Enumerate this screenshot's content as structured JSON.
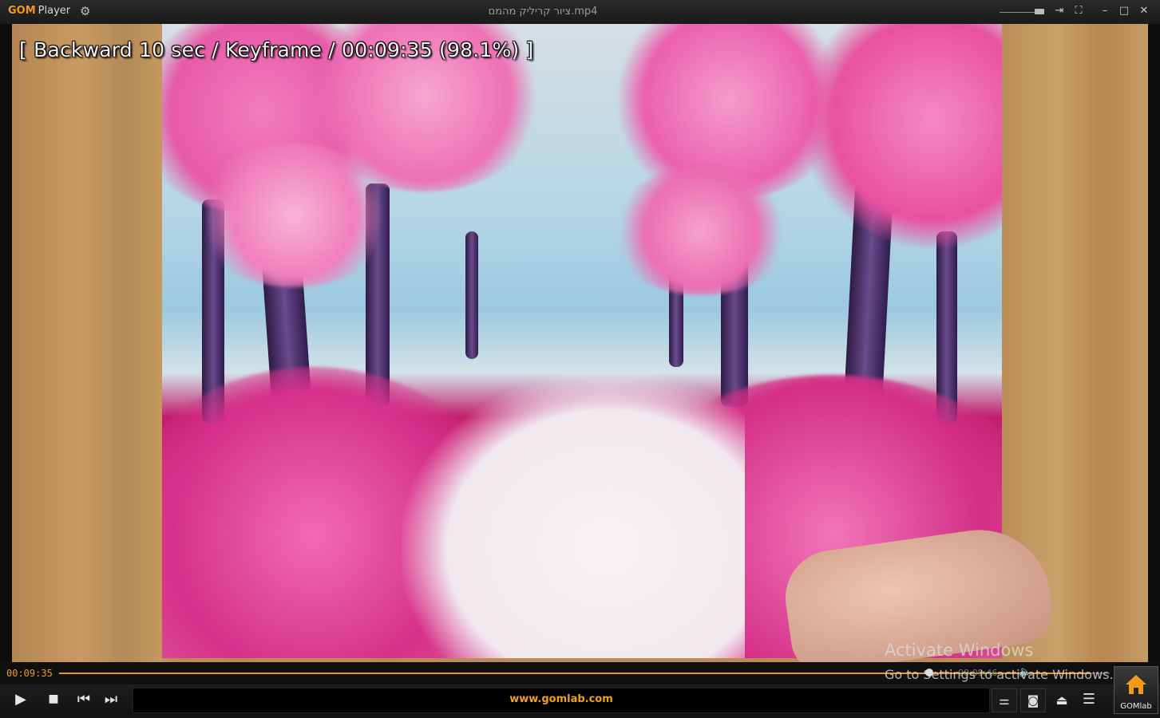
{
  "titlebar": {
    "brand": "GOM",
    "brand_sub": "Player",
    "file_title": "ציור קריליק מהמם.mp4"
  },
  "osd": {
    "message": "[ Backward 10 sec / Keyframe / 00:09:35 (98.1%) ]"
  },
  "seek": {
    "current_time": "00:09:35",
    "progress_fraction": 0.981,
    "total_time_partial": "00:09:46"
  },
  "ad": {
    "text": "www.gomlab.com"
  },
  "gomlab_button": {
    "label": "GOMlab"
  },
  "watermark": {
    "line1": "Activate Windows",
    "line2": "Go to Settings to activate Windows."
  },
  "colors": {
    "accent": "#e8961e",
    "brand": "#f29b1a"
  }
}
